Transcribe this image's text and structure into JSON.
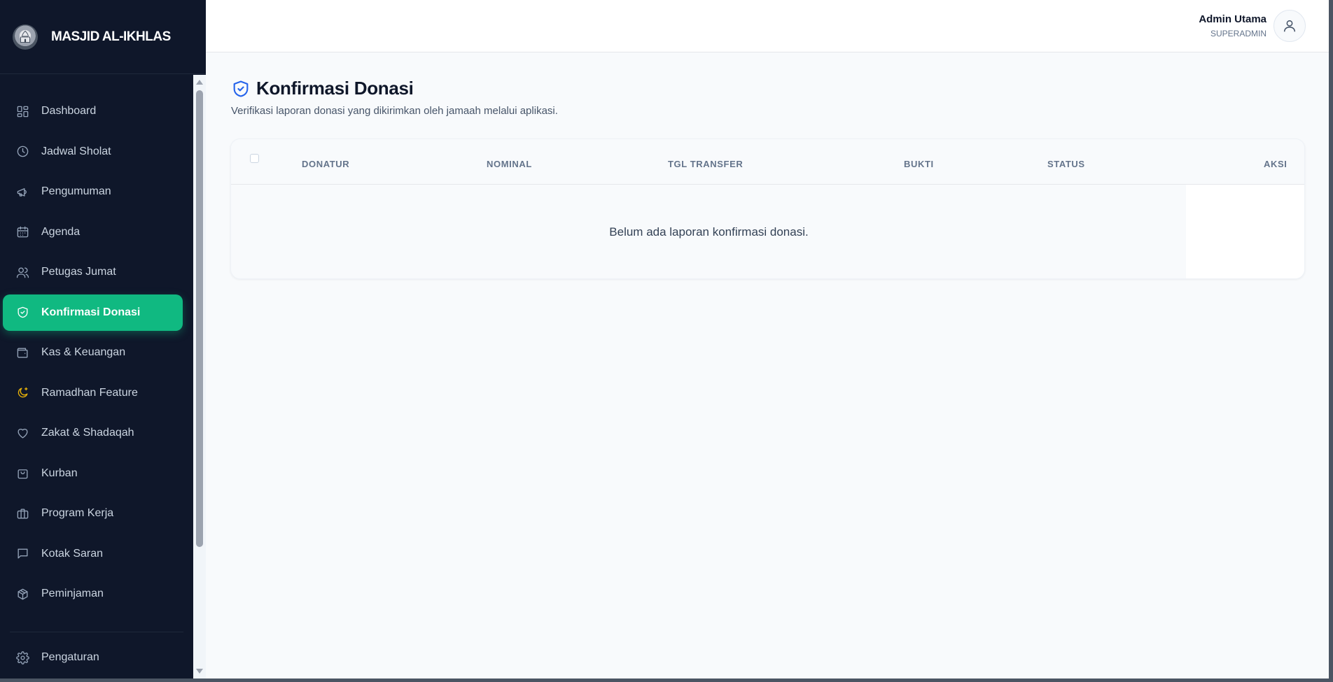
{
  "brand": {
    "name": "MASJID AL-IKHLAS"
  },
  "sidebar": {
    "items": [
      {
        "label": "Dashboard",
        "icon": "grid-icon"
      },
      {
        "label": "Jadwal Sholat",
        "icon": "clock-icon"
      },
      {
        "label": "Pengumuman",
        "icon": "megaphone-icon"
      },
      {
        "label": "Agenda",
        "icon": "calendar-icon"
      },
      {
        "label": "Petugas Jumat",
        "icon": "users-icon"
      },
      {
        "label": "Konfirmasi Donasi",
        "icon": "shield-check-icon",
        "active": true
      },
      {
        "label": "Kas & Keuangan",
        "icon": "wallet-icon"
      },
      {
        "label": "Ramadhan Feature",
        "icon": "moon-star-icon"
      },
      {
        "label": "Zakat & Shadaqah",
        "icon": "heart-icon"
      },
      {
        "label": "Kurban",
        "icon": "shopping-bag-icon"
      },
      {
        "label": "Program Kerja",
        "icon": "briefcase-icon"
      },
      {
        "label": "Kotak Saran",
        "icon": "message-square-icon"
      },
      {
        "label": "Peminjaman",
        "icon": "package-icon"
      }
    ],
    "footer_item": {
      "label": "Pengaturan",
      "icon": "gear-icon"
    }
  },
  "header": {
    "user_name": "Admin Utama",
    "user_role": "SUPERADMIN"
  },
  "main": {
    "title": "Konfirmasi Donasi",
    "subtitle": "Verifikasi laporan donasi yang dikirimkan oleh jamaah melalui aplikasi.",
    "table": {
      "columns": [
        "DONATUR",
        "NOMINAL",
        "TGL TRANSFER",
        "BUKTI",
        "STATUS",
        "AKSI"
      ],
      "rows": [],
      "empty_message": "Belum ada laporan konfirmasi donasi."
    }
  },
  "colors": {
    "sidebar_bg": "#0f172a",
    "active_item": "#10b981",
    "title_icon": "#2563eb",
    "ramadhan_icon": "#eab308"
  }
}
